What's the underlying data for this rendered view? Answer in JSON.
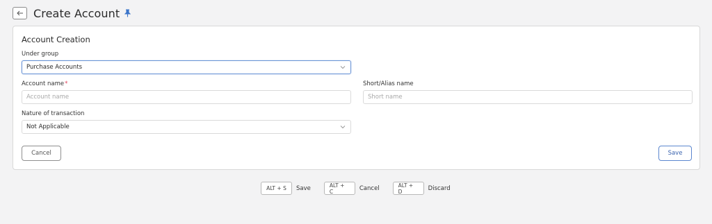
{
  "header": {
    "title": "Create Account",
    "back_icon": "arrow-left-icon",
    "pin_icon": "pin-icon",
    "accent": "#3a74c9"
  },
  "form": {
    "title": "Account Creation",
    "under_group": {
      "label": "Under group",
      "value": "Purchase Accounts"
    },
    "account_name": {
      "label": "Account name",
      "required_mark": "*",
      "placeholder": "Account name",
      "value": ""
    },
    "short_name": {
      "label": "Short/Alias name",
      "placeholder": "Short name",
      "value": ""
    },
    "nature": {
      "label": "Nature of transaction",
      "value": "Not Applicable"
    },
    "cancel_label": "Cancel",
    "save_label": "Save"
  },
  "shortcuts": [
    {
      "keys": "ALT + S",
      "label": "Save"
    },
    {
      "keys": "ALT + C",
      "label": "Cancel"
    },
    {
      "keys": "ALT + D",
      "label": "Discard"
    }
  ]
}
